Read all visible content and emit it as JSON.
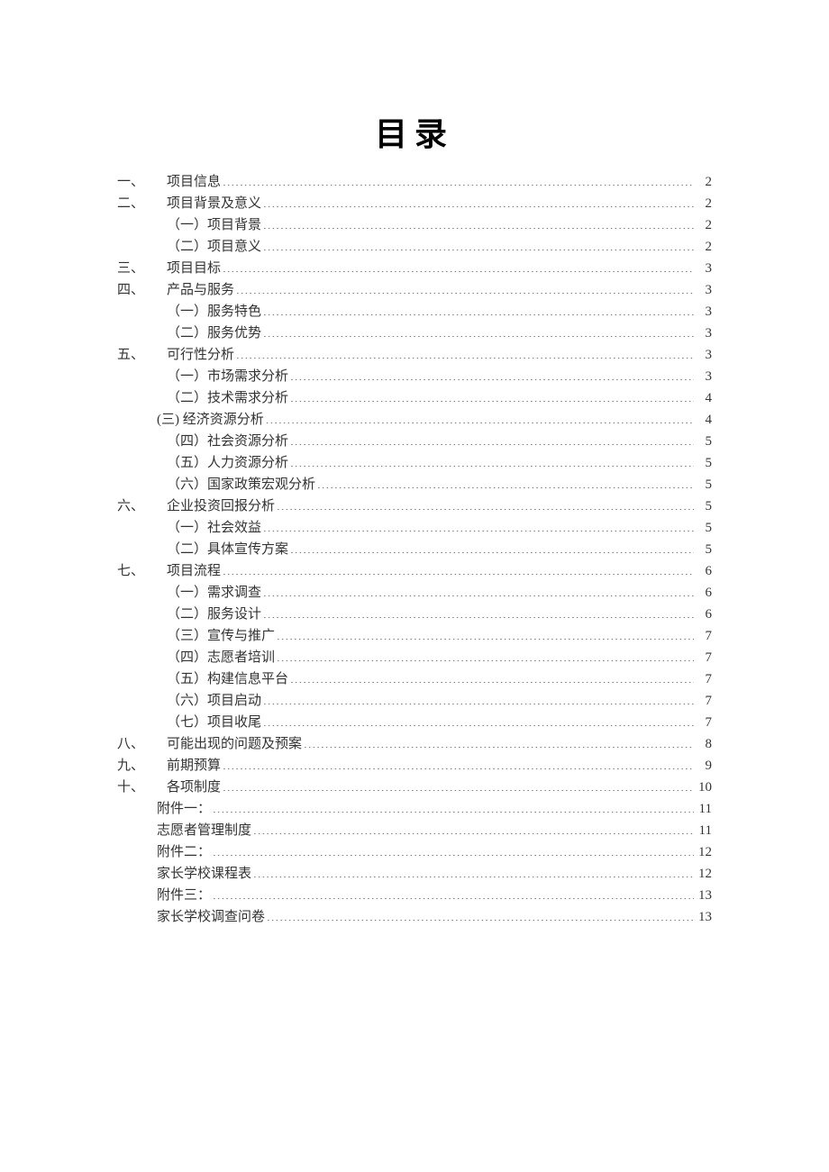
{
  "title": "目录",
  "toc": [
    {
      "marker": "一、",
      "label": "项目信息",
      "page": "2",
      "indent": 0
    },
    {
      "marker": "二、",
      "label": "项目背景及意义",
      "page": "2",
      "indent": 0
    },
    {
      "marker": "",
      "label": "（一）项目背景",
      "page": "2",
      "indent": 1
    },
    {
      "marker": "",
      "label": "（二）项目意义",
      "page": "2",
      "indent": 1
    },
    {
      "marker": "三、",
      "label": "项目目标",
      "page": "3",
      "indent": 0
    },
    {
      "marker": "四、",
      "label": "产品与服务",
      "page": "3",
      "indent": 0
    },
    {
      "marker": "",
      "label": "（一）服务特色",
      "page": "3",
      "indent": 1
    },
    {
      "marker": "",
      "label": "（二）服务优势",
      "page": "3",
      "indent": 1
    },
    {
      "marker": "五、",
      "label": "可行性分析",
      "page": "3",
      "indent": 0
    },
    {
      "marker": "",
      "label": "（一）市场需求分析",
      "page": "3",
      "indent": 1
    },
    {
      "marker": "",
      "label": "（二）技术需求分析",
      "page": "4",
      "indent": 1
    },
    {
      "marker": "",
      "label": "(三) 经济资源分析",
      "page": "4",
      "indent": 2
    },
    {
      "marker": "",
      "label": "（四）社会资源分析",
      "page": "5",
      "indent": 1
    },
    {
      "marker": "",
      "label": "（五）人力资源分析",
      "page": "5",
      "indent": 1
    },
    {
      "marker": "",
      "label": "（六）国家政策宏观分析",
      "page": "5",
      "indent": 1
    },
    {
      "marker": "六、",
      "label": "企业投资回报分析",
      "page": "5",
      "indent": 0
    },
    {
      "marker": "",
      "label": "（一）社会效益",
      "page": "5",
      "indent": 1
    },
    {
      "marker": "",
      "label": "（二）具体宣传方案",
      "page": "5",
      "indent": 1
    },
    {
      "marker": "七、",
      "label": "项目流程",
      "page": "6",
      "indent": 0
    },
    {
      "marker": "",
      "label": "（一）需求调查",
      "page": "6",
      "indent": 1
    },
    {
      "marker": "",
      "label": "（二）服务设计",
      "page": "6",
      "indent": 1
    },
    {
      "marker": "",
      "label": "（三）宣传与推广",
      "page": "7",
      "indent": 1
    },
    {
      "marker": "",
      "label": "（四）志愿者培训",
      "page": "7",
      "indent": 1
    },
    {
      "marker": "",
      "label": "（五）构建信息平台",
      "page": "7",
      "indent": 1
    },
    {
      "marker": "",
      "label": "（六）项目启动",
      "page": "7",
      "indent": 1
    },
    {
      "marker": "",
      "label": "（七）项目收尾",
      "page": "7",
      "indent": 1
    },
    {
      "marker": "八、",
      "label": "可能出现的问题及预案",
      "page": "8",
      "indent": 0
    },
    {
      "marker": "九、",
      "label": "前期预算",
      "page": "9",
      "indent": 0
    },
    {
      "marker": "十、",
      "label": "各项制度",
      "page": "10",
      "indent": 0
    },
    {
      "marker": "",
      "label": "附件一：",
      "page": "11",
      "indent": 2
    },
    {
      "marker": "",
      "label": "志愿者管理制度",
      "page": "11",
      "indent": 2
    },
    {
      "marker": "",
      "label": "附件二：",
      "page": "12",
      "indent": 2
    },
    {
      "marker": "",
      "label": "家长学校课程表",
      "page": "12",
      "indent": 2
    },
    {
      "marker": "",
      "label": "附件三：",
      "page": "13",
      "indent": 2
    },
    {
      "marker": "",
      "label": "家长学校调查问卷",
      "page": "13",
      "indent": 2
    }
  ]
}
